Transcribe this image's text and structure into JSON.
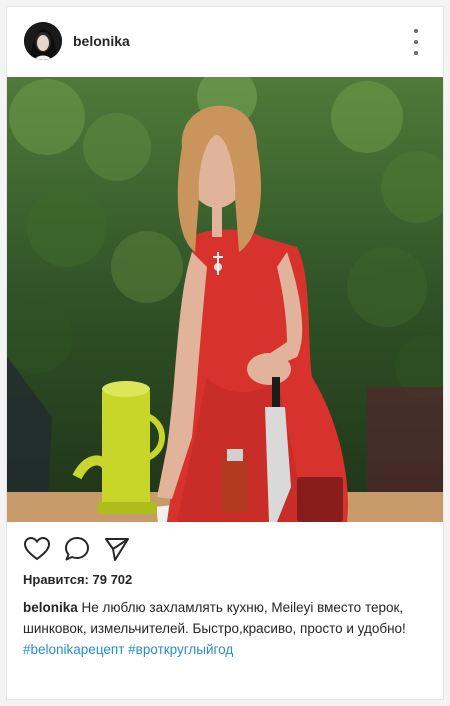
{
  "post": {
    "username": "belonika",
    "likes_label": "Нравится: 79 702",
    "caption_user": "belonika",
    "caption_text": "Не люблю захламлять кухню, Meileyi вместо терок, шинковок, измельчителей. Быстро,красиво, просто и удобно!",
    "hashtags": [
      "#belonikaрецепт",
      "#вроткруглыйгод"
    ]
  },
  "icons": {
    "more": "more-vertical-icon",
    "like": "heart-icon",
    "comment": "comment-icon",
    "share": "share-icon"
  },
  "colors": {
    "hashtag": "#2a8ec9",
    "dress": "#d8322c",
    "grater": "#c8d62a"
  }
}
